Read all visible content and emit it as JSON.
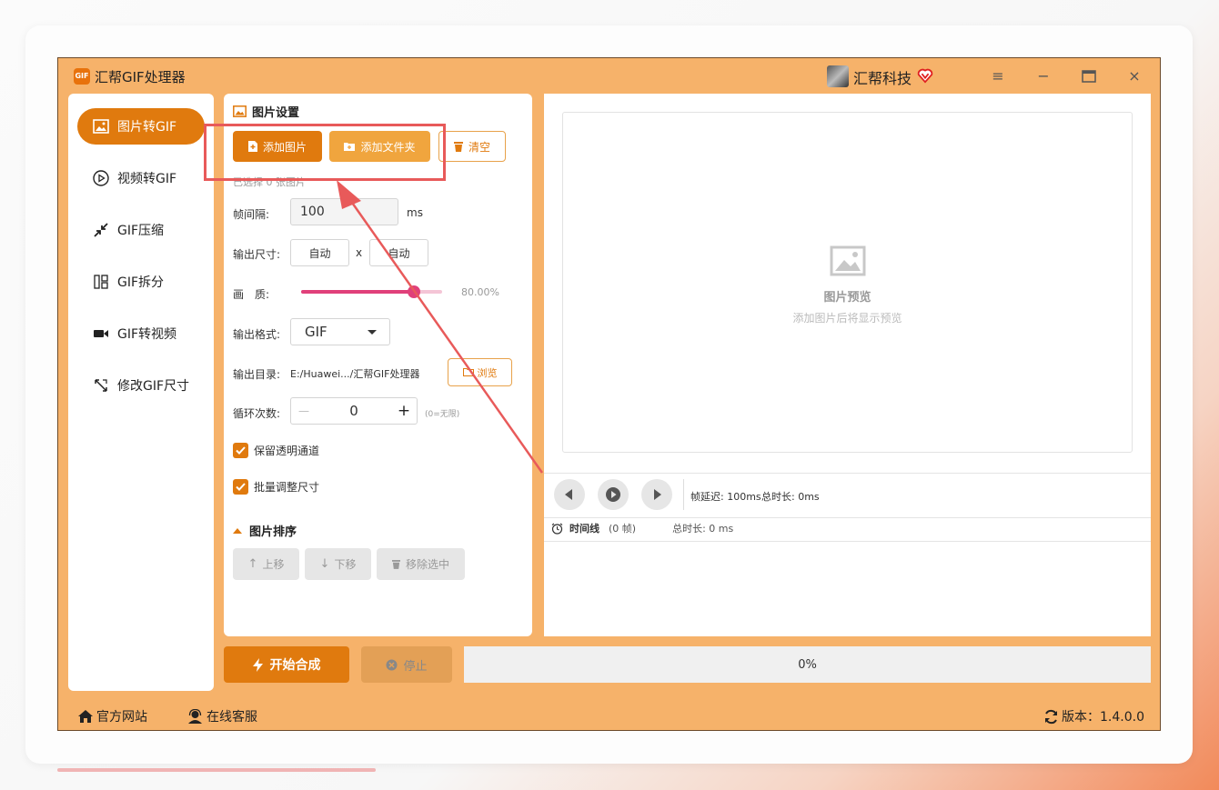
{
  "app": {
    "title": "汇帮GIF处理器",
    "logo_text": "GIF"
  },
  "brand": {
    "name": "汇帮科技"
  },
  "window_controls": {
    "menu": "≡",
    "minimize": "−",
    "maximize": "□",
    "close": "×"
  },
  "sidebar": {
    "items": [
      {
        "label": "图片转GIF",
        "icon": "image-icon",
        "active": true
      },
      {
        "label": "视频转GIF",
        "icon": "play-circle-icon"
      },
      {
        "label": "GIF压缩",
        "icon": "compress-icon"
      },
      {
        "label": "GIF拆分",
        "icon": "split-icon"
      },
      {
        "label": "GIF转视频",
        "icon": "video-camera-icon"
      },
      {
        "label": "修改GIF尺寸",
        "icon": "resize-icon"
      }
    ]
  },
  "settings": {
    "title": "图片设置",
    "add_image": "添加图片",
    "add_folder": "添加文件夹",
    "clear": "清空",
    "selected_info": "已选择 0 张图片",
    "interval_label": "帧间隔:",
    "interval_value": "100",
    "interval_unit": "ms",
    "size_label": "输出尺寸:",
    "width_value": "自动",
    "size_sep": "x",
    "height_value": "自动",
    "quality_label": "画　质:",
    "quality_value": "80.00%",
    "quality_fraction": 0.8,
    "format_label": "输出格式:",
    "format_value": "GIF",
    "dir_label": "输出目录:",
    "dir_value": "E:/Huawei.../汇帮GIF处理器",
    "browse": "浏览",
    "loop_label": "循环次数:",
    "loop_minus": "—",
    "loop_value": "0",
    "loop_plus": "+",
    "loop_hint": "(0=无限)",
    "keep_alpha": "保留透明通道",
    "batch_resize": "批量调整尺寸",
    "sort_title": "图片排序",
    "move_up": "上移",
    "move_down": "下移",
    "remove_selected": "移除选中"
  },
  "preview": {
    "title": "图片预览",
    "hint": "添加图片后将显示预览",
    "frame_delay": "帧延迟: 100ms",
    "total_duration": "总时长: 0ms",
    "timeline_label": "时间线",
    "timeline_frames": "(0 帧)",
    "timeline_duration": "总时长: 0 ms"
  },
  "actions": {
    "start": "开始合成",
    "stop": "停止",
    "progress": "0%"
  },
  "footer": {
    "website": "官方网站",
    "support": "在线客服",
    "version": "版本：1.4.0.0"
  },
  "colors": {
    "accent": "#e07a0e",
    "app_bg": "#f6b26a",
    "annotation": "#e85a5a",
    "slider": "#e0407a"
  }
}
